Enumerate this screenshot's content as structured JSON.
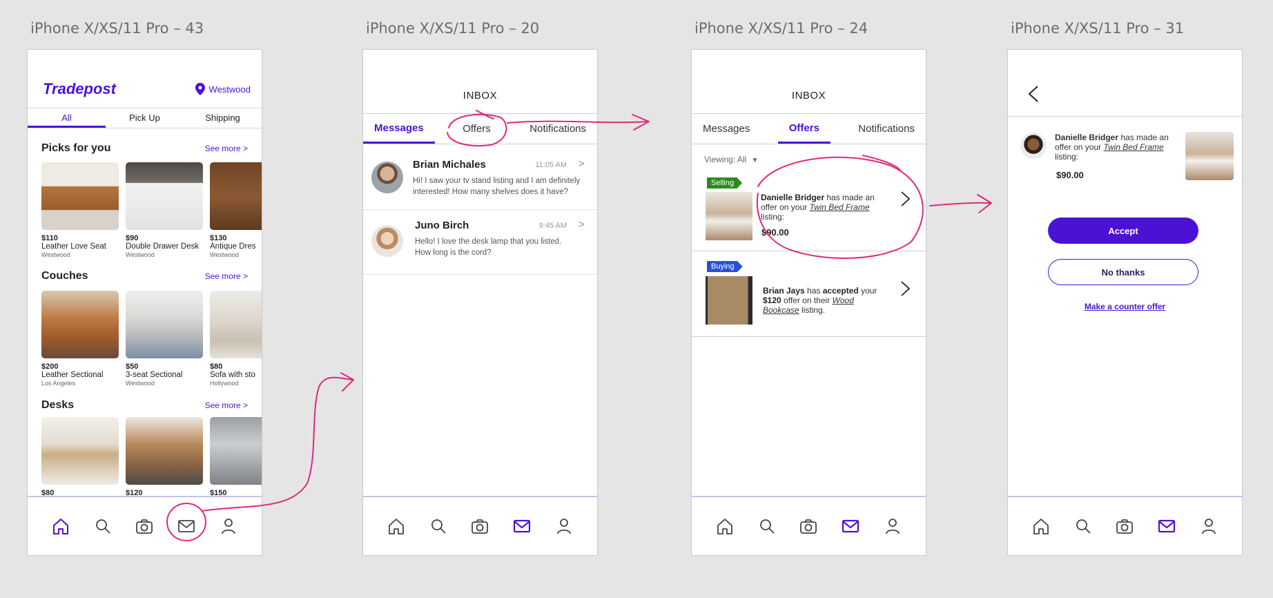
{
  "frames": [
    {
      "label": "iPhone X/XS/11 Pro – 43"
    },
    {
      "label": "iPhone X/XS/11 Pro – 20"
    },
    {
      "label": "iPhone X/XS/11 Pro – 24"
    },
    {
      "label": "iPhone X/XS/11 Pro – 31"
    }
  ],
  "colors": {
    "accent": "#4b12d6",
    "annotation": "#e0287a",
    "selling_flag": "#2e8a1e",
    "buying_flag": "#2a4fd6"
  },
  "home": {
    "logo": "Tradepost",
    "location": "Westwood",
    "tabs": [
      "All",
      "Pick Up",
      "Shipping"
    ],
    "see_more": "See more >",
    "sections": [
      {
        "title": "Picks for you",
        "items": [
          {
            "price": "$110",
            "name": "Leather Love Seat",
            "location": "Westwood"
          },
          {
            "price": "$90",
            "name": "Double Drawer Desk",
            "location": "Westwood"
          },
          {
            "price": "$130",
            "name": "Antique Dres",
            "location": "Westwood"
          }
        ]
      },
      {
        "title": "Couches",
        "items": [
          {
            "price": "$200",
            "name": "Leather Sectional",
            "location": "Los Angeles"
          },
          {
            "price": "$50",
            "name": "3-seat Sectional",
            "location": "Westwood"
          },
          {
            "price": "$80",
            "name": "Sofa with sto",
            "location": "Hollywood"
          }
        ]
      },
      {
        "title": "Desks",
        "items": [
          {
            "price": "$80"
          },
          {
            "price": "$120"
          },
          {
            "price": "$150"
          }
        ]
      }
    ]
  },
  "inbox": {
    "title": "INBOX",
    "tabs": [
      "Messages",
      "Offers",
      "Notifications"
    ],
    "messages": [
      {
        "name": "Brian Michales",
        "time": "11:05 AM",
        "body": "Hi! I saw your tv stand listing and I am definitely interested! How many shelves does it have?"
      },
      {
        "name": "Juno Birch",
        "time": "9:45 AM",
        "body": "Hello! I love the desk lamp that you listed. How long is the cord?"
      }
    ],
    "chevron": ">"
  },
  "offers": {
    "viewing": "Viewing: All",
    "items": [
      {
        "flag": "Selling",
        "who": "Danielle Bridger",
        "pre": " has made an offer on your ",
        "listing": "Twin Bed Frame",
        "post": " listing:",
        "price": "$90.00"
      },
      {
        "flag": "Buying",
        "who": "Brian Jays",
        "mid1": " has ",
        "accepted": "accepted",
        "mid2": " your ",
        "amount": "$120",
        "mid3": " offer on their ",
        "listing": "Wood Bookcase",
        "post": " listing."
      }
    ]
  },
  "detail": {
    "who": "Danielle Bridger",
    "pre": " has made an offer on your ",
    "listing": "Twin Bed Frame",
    "post": " listing:",
    "price": "$90.00",
    "accept": "Accept",
    "decline": "No thanks",
    "counter": "Make a counter offer"
  }
}
